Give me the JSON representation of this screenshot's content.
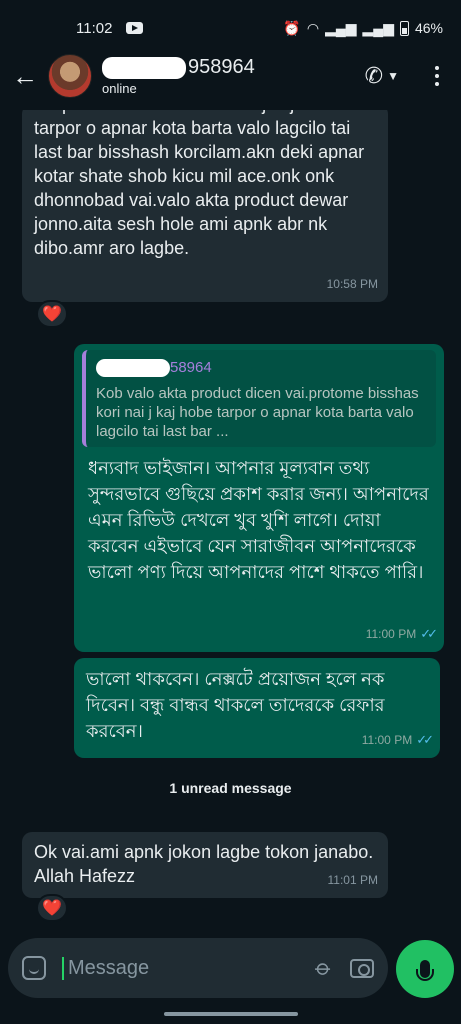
{
  "status_bar": {
    "time": "11:02",
    "battery": "46%"
  },
  "header": {
    "contact_name_visible": "958964",
    "contact_status": "online",
    "icons": [
      "back-arrow-icon",
      "phone-icon",
      "more-vert-icon"
    ]
  },
  "messages": [
    {
      "direction": "incoming",
      "text": "vai.protome bisshas kori nai j kaj hobe tarpor o apnar kota barta valo lagcilo tai last bar bisshash korcilam.akn deki apnar kotar shate shob kicu mil ace.onk onk dhonnobad vai.valo akta product dewar jonno.aita sesh hole ami apnk abr nk dibo.amr aro lagbe.",
      "time": "10:58 PM",
      "reaction": "❤️"
    },
    {
      "direction": "outgoing",
      "quote_name": "58964",
      "quote_text": "Kob valo akta product dicen vai.protome bisshas kori nai j kaj hobe tarpor o apnar kota barta valo lagcilo tai last bar ...",
      "text": "ধন্যবাদ ভাইজান। আপনার মূল্যবান তথ্য সুন্দরভাবে গুছিয়ে প্রকাশ করার জন্য। আপনাদের এমন রিভিউ দেখলে খুব খুশি লাগে। দোয়া করবেন এইভাবে যেন সারাজীবন আপনাদেরকে ভালো পণ্য দিয়ে আপনাদের পাশে থাকতে পারি।",
      "time": "11:00 PM"
    },
    {
      "direction": "outgoing",
      "text": "ভালো থাকবেন। নেক্সটে প্রয়োজন হলে নক দিবেন। বন্ধু বান্ধব থাকলে তাদেরকে রেফার করবেন।",
      "time": "11:00 PM"
    },
    {
      "direction": "incoming",
      "text": "Ok vai.ami apnk jokon lagbe tokon janabo. Allah Hafezz",
      "time": "11:01 PM",
      "reaction": "❤️"
    }
  ],
  "unread_label": "1 unread message",
  "composer": {
    "placeholder": "Message"
  },
  "colors": {
    "background": "#0b141a",
    "incoming_bubble": "#202c33",
    "outgoing_bubble": "#005c4b",
    "accent_green": "#21c063",
    "read_ticks": "#53bdeb"
  }
}
